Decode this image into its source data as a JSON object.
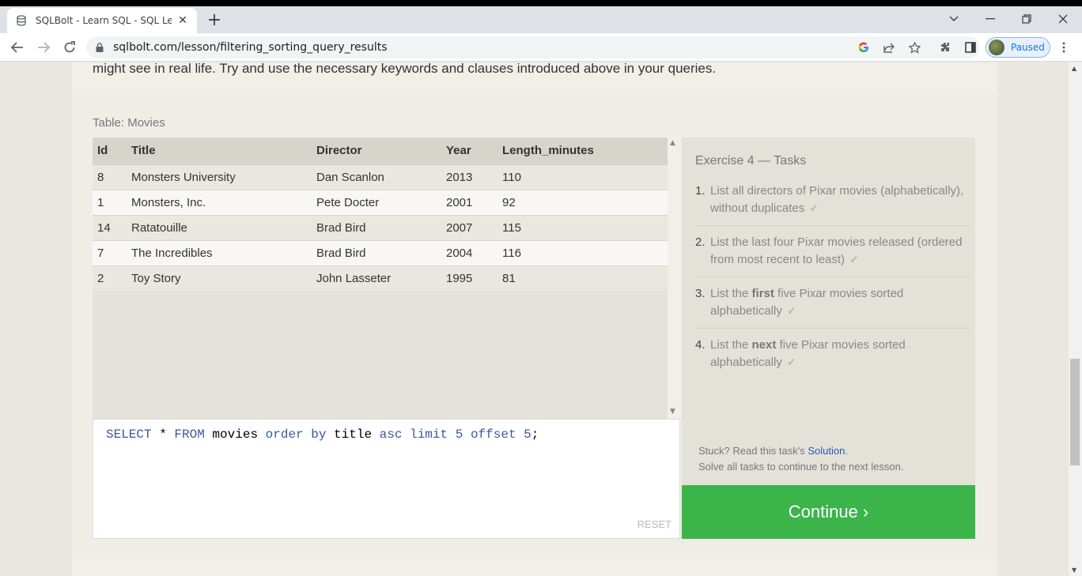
{
  "browser": {
    "tab_title": "SQLBolt - Learn SQL - SQL Lesso",
    "tab_close": "✕",
    "new_tab": "+",
    "url": "sqlbolt.com/lesson/filtering_sorting_query_results",
    "profile_status": "Paused"
  },
  "page": {
    "intro_text": "might see in real life. Try and use the necessary keywords and clauses introduced above in your queries.",
    "table_caption": "Table: Movies",
    "columns": [
      "Id",
      "Title",
      "Director",
      "Year",
      "Length_minutes"
    ],
    "rows": [
      [
        "8",
        "Monsters University",
        "Dan Scanlon",
        "2013",
        "110"
      ],
      [
        "1",
        "Monsters, Inc.",
        "Pete Docter",
        "2001",
        "92"
      ],
      [
        "14",
        "Ratatouille",
        "Brad Bird",
        "2007",
        "115"
      ],
      [
        "7",
        "The Incredibles",
        "Brad Bird",
        "2004",
        "116"
      ],
      [
        "2",
        "Toy Story",
        "John Lasseter",
        "1995",
        "81"
      ]
    ],
    "query_tokens": {
      "select": "SELECT",
      "star": " * ",
      "from": "FROM",
      "table": " movies ",
      "order_by": "order by",
      "column": " title ",
      "asc": "asc",
      "limit": "limit",
      "limit_val": "5",
      "offset": "offset",
      "offset_val": "5",
      "semicolon": ";"
    },
    "reset_label": "RESET",
    "exercise_title": "Exercise 4 — Tasks",
    "tasks": [
      {
        "num": "1.",
        "text": "List all directors of Pixar movies (alphabetically), without duplicates",
        "done": "✓"
      },
      {
        "num": "2.",
        "text": "List the last four Pixar movies released (ordered from most recent to least)",
        "done": "✓"
      },
      {
        "num": "3.",
        "pre": "List the ",
        "bold": "first",
        "post": " five Pixar movies sorted alphabetically",
        "done": "✓"
      },
      {
        "num": "4.",
        "pre": "List the ",
        "bold": "next",
        "post": " five Pixar movies sorted alphabetically",
        "done": "✓"
      }
    ],
    "stuck_prefix": "Stuck? Read this task's ",
    "solution_link": "Solution",
    "stuck_suffix": ".",
    "solve_all": "Solve all tasks to continue to the next lesson.",
    "continue_label": "Continue ›"
  },
  "colors": {
    "continue_bg": "#3bb54a",
    "sql_keyword": "#3a5a9a",
    "link": "#2a5db0",
    "check": "#7ec27e"
  }
}
